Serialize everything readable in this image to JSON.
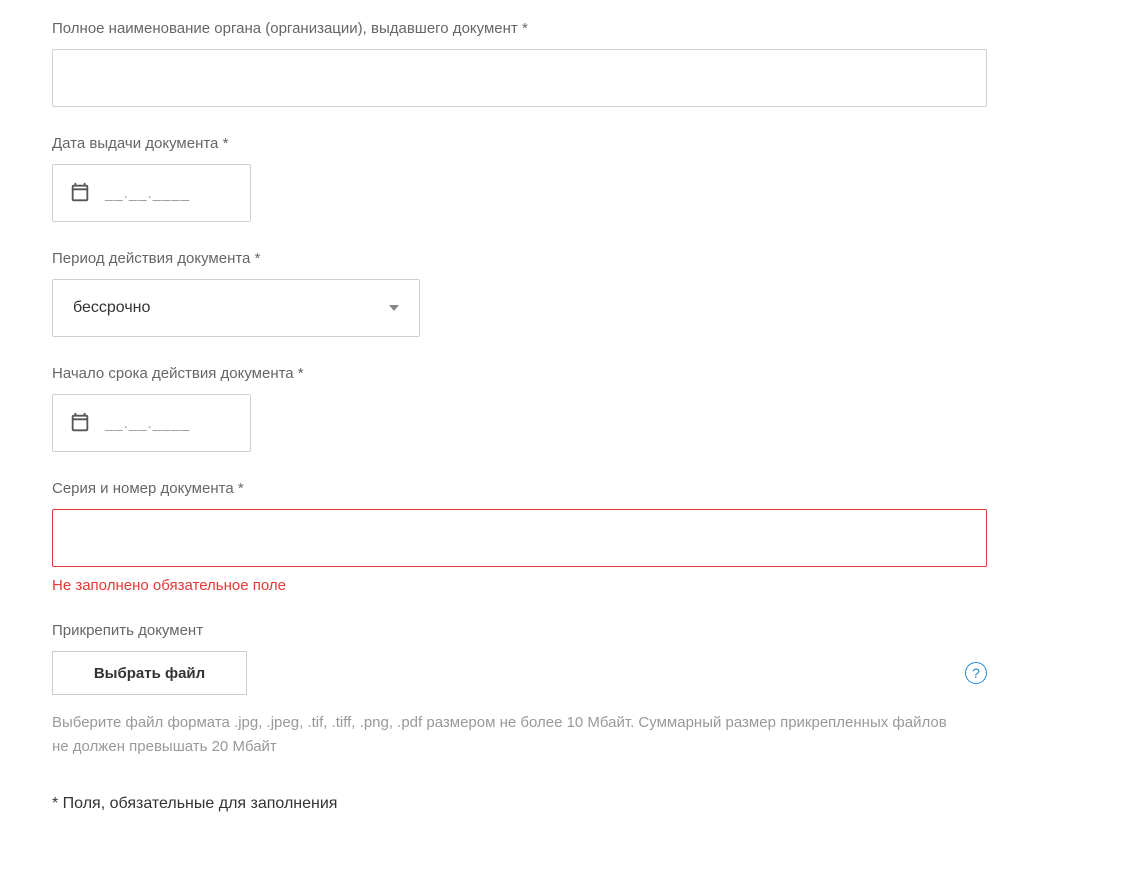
{
  "fields": {
    "issuer": {
      "label": "Полное наименование органа (организации), выдавшего документ *",
      "value": ""
    },
    "issue_date": {
      "label": "Дата выдачи документа *",
      "placeholder": "__.__.____"
    },
    "validity_period": {
      "label": "Период действия документа *",
      "selected": "бессрочно"
    },
    "start_date": {
      "label": "Начало срока действия документа *",
      "placeholder": "__.__.____"
    },
    "serial_number": {
      "label": "Серия и номер документа *",
      "value": "",
      "error": "Не заполнено обязательное поле"
    },
    "attach": {
      "label": "Прикрепить документ",
      "button": "Выбрать файл",
      "hint": "Выберите файл формата .jpg, .jpeg, .tif, .tiff, .png, .pdf размером не более 10 Мбайт. Суммарный размер прикрепленных файлов не должен превышать 20 Мбайт",
      "help": "?"
    }
  },
  "required_note": "* Поля, обязательные для заполнения"
}
